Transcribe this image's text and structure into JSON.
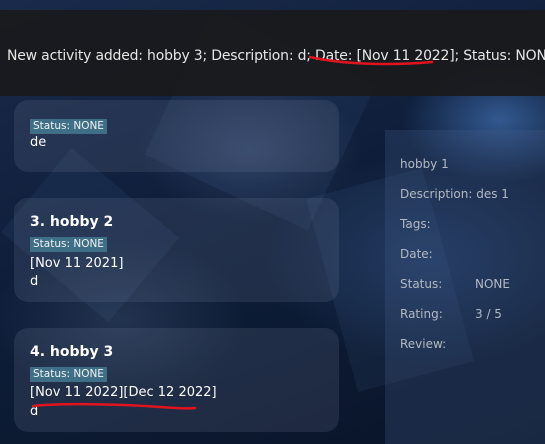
{
  "result": {
    "message": "New activity added: hobby 3; Description: d; Date: [Nov 11 2022]; Status: NONE"
  },
  "list": {
    "items": [
      {
        "title": "",
        "status": "Status: NONE",
        "dates": "",
        "description": "de"
      },
      {
        "title": "3.  hobby 2",
        "status": "Status: NONE",
        "dates": "[Nov 11 2021]",
        "description": "d"
      },
      {
        "title": "4.  hobby 3",
        "status": "Status: NONE",
        "dates": "[Nov 11 2022][Dec 12 2022]",
        "description": "d"
      }
    ]
  },
  "detail": {
    "name": "hobby 1",
    "description": "Description: des 1",
    "tags_label": "Tags:",
    "date_label": "Date:",
    "status_label": "Status:",
    "status_value": "NONE",
    "rating_label": "Rating:",
    "rating_value": "3 / 5",
    "review_label": "Review:"
  },
  "colors": {
    "badge": "#3f6f86",
    "annotation": "#e0141e",
    "banner": "#1a1a1c"
  }
}
